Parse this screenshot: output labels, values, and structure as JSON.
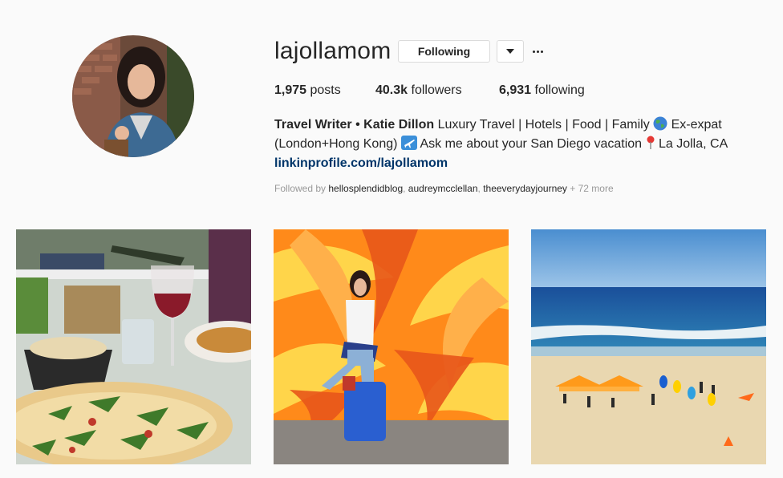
{
  "profile": {
    "username": "lajollamom",
    "following_button": "Following",
    "stats": {
      "posts_count": "1,975",
      "posts_label": "posts",
      "followers_count": "40.3k",
      "followers_label": "followers",
      "following_count": "6,931",
      "following_label": "following"
    },
    "bio": {
      "name": "Travel Writer • Katie Dillon",
      "text_part1": "Luxury Travel | Hotels | Food | Family",
      "text_part2": "Ex-expat (London+Hong Kong)",
      "text_part3": "Ask me about your San Diego vacation",
      "text_part4": "La Jolla, CA",
      "link": "linkinprofile.com/lajollamom"
    },
    "followed_by": {
      "prefix": "Followed by",
      "users": [
        "hellosplendidblog",
        "audreymcclellan",
        "theeverydayjourney"
      ],
      "sep": ", ",
      "more": "+ 72 more"
    }
  },
  "icons": {
    "dropdown": "chevron-down-icon",
    "more": "more-options-icon",
    "globe": "globe-emoji",
    "airplane": "airplane-emoji",
    "pin": "pin-emoji"
  },
  "colors": {
    "background": "#fafafa",
    "link": "#003569",
    "button_border": "#dbdbdb",
    "muted_text": "#999999"
  }
}
